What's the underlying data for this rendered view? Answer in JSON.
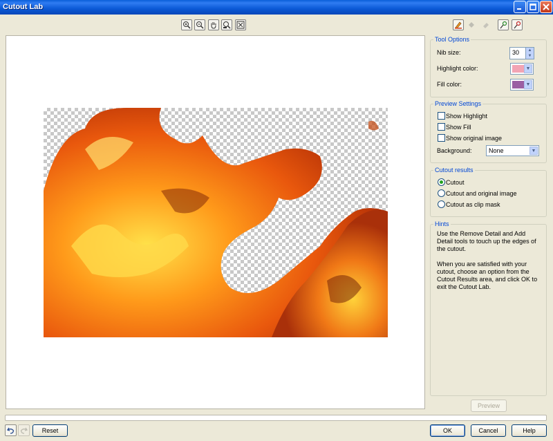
{
  "window": {
    "title": "Cutout Lab",
    "controls": [
      "minimize-icon",
      "maximize-icon",
      "close-icon"
    ]
  },
  "zoom_toolbar": [
    "zoom-in-icon",
    "zoom-out-icon",
    "pan-hand-icon",
    "zoom-fit-icon",
    "zoom-actual-icon"
  ],
  "edit_tools": [
    {
      "icon": "highlighter-icon",
      "enabled": true
    },
    {
      "icon": "fill-bucket-icon",
      "enabled": false
    },
    {
      "icon": "eraser-icon",
      "enabled": false
    },
    {
      "icon": "add-detail-icon",
      "enabled": true
    },
    {
      "icon": "remove-detail-icon",
      "enabled": true
    }
  ],
  "tool_options": {
    "heading": "Tool Options",
    "nib_size_label": "Nib size:",
    "nib_size_value": "30",
    "highlight_color_label": "Highlight color:",
    "highlight_color": "#f2a4b4",
    "fill_color_label": "Fill color:",
    "fill_color": "#9b5fa3"
  },
  "preview_settings": {
    "heading": "Preview Settings",
    "show_highlight": {
      "label": "Show Highlight",
      "checked": false
    },
    "show_fill": {
      "label": "Show Fill",
      "checked": false
    },
    "show_original": {
      "label": "Show original image",
      "checked": false
    },
    "background_label": "Background:",
    "background_value": "None"
  },
  "cutout_results": {
    "heading": "Cutout results",
    "options": [
      {
        "label": "Cutout",
        "selected": true
      },
      {
        "label": "Cutout and original image",
        "selected": false
      },
      {
        "label": "Cutout as clip mask",
        "selected": false
      }
    ]
  },
  "hints": {
    "heading": "Hints",
    "para1": "Use the Remove Detail and Add Detail tools to touch up the edges of the cutout.",
    "para2": "When you are satisfied with your cutout, choose an option from the Cutout Results area, and click OK to exit the Cutout Lab."
  },
  "buttons": {
    "preview": "Preview",
    "reset": "Reset",
    "ok": "OK",
    "cancel": "Cancel",
    "help": "Help"
  },
  "history": [
    "undo-icon",
    "redo-icon"
  ],
  "progress": 0
}
